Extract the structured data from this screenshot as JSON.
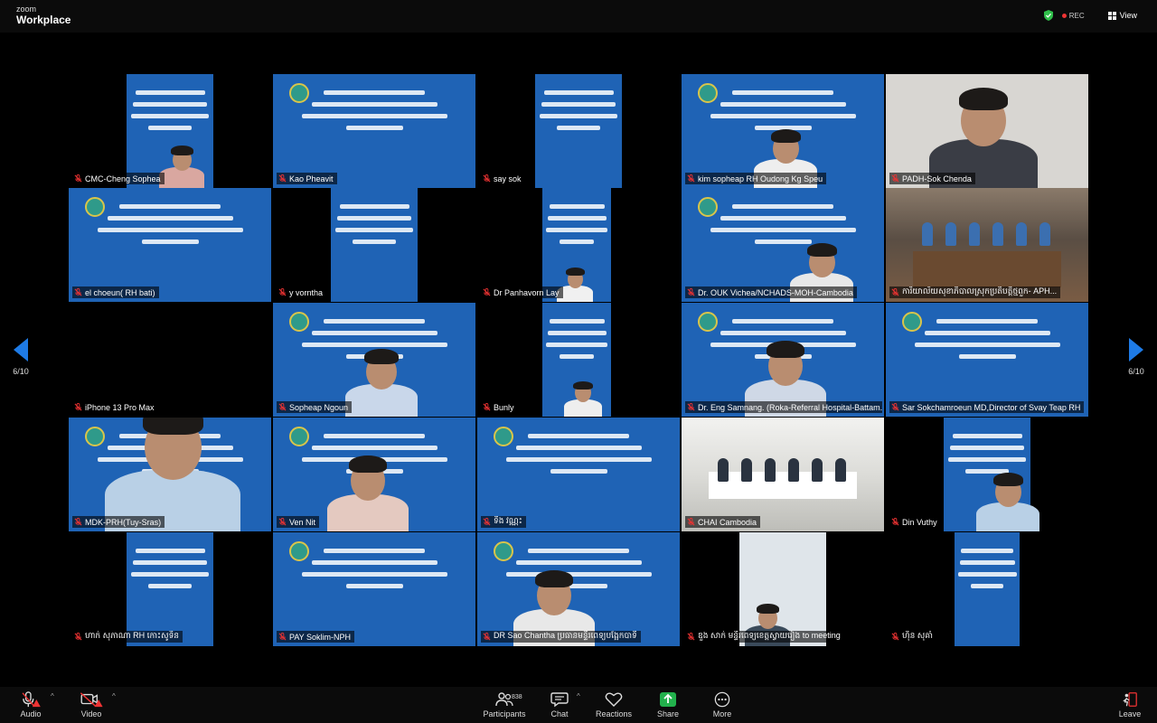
{
  "app": {
    "brand_small": "zoom",
    "brand": "Workplace",
    "rec": "REC",
    "view": "View"
  },
  "page_indicator": {
    "left": "6/10",
    "right": "6/10"
  },
  "participants": [
    {
      "name": "CMC-Cheng Sophea"
    },
    {
      "name": "Kao Pheavit"
    },
    {
      "name": "say sok"
    },
    {
      "name": "kim sopheap RH Oudong Kg Speu"
    },
    {
      "name": "PADH-Sok Chenda"
    },
    {
      "name": "el choeun( RH bati)"
    },
    {
      "name": "y vorntha"
    },
    {
      "name": "Dr Panhavorn Lay"
    },
    {
      "name": "Dr. OUK Vichea/NCHADS-MOH-Cambodia"
    },
    {
      "name": "ការិយាល័យសុខាភិបាលស្រុកប្រតិបត្តិថ្មពួក- APH..."
    },
    {
      "name": "iPhone 13 Pro Max"
    },
    {
      "name": "Sopheap Ngoun"
    },
    {
      "name": "Bunly"
    },
    {
      "name": "Dr. Eng Samnang. (Roka-Referral Hospital-Battam..."
    },
    {
      "name": "Sar Sokchamroeun MD,Director of Svay Teap RH"
    },
    {
      "name": "MDK-PRH(Tuy-Sras)"
    },
    {
      "name": "Ven Nit"
    },
    {
      "name": "ទីង វណ្ណះ"
    },
    {
      "name": "CHAI Cambodia"
    },
    {
      "name": "Din Vuthy"
    },
    {
      "name": "ហាក់ សុភាណា RH កោះសូទិន"
    },
    {
      "name": "PAY Soklim-NPH"
    },
    {
      "name": "DR Sao Chantha ប្រធានមន្ទីរពេទ្យបង្អែកបាទី"
    },
    {
      "name": "ឌួង សាក់ មន្ទីរពេទ្យខេត្តស្វាយរៀង to meeting"
    },
    {
      "name": "ហ៊ិន សុគាំ"
    }
  ],
  "toolbar": {
    "audio": "Audio",
    "video": "Video",
    "participants": "Participants",
    "participants_count": "838",
    "chat": "Chat",
    "reactions": "Reactions",
    "share": "Share",
    "more": "More",
    "leave": "Leave"
  }
}
